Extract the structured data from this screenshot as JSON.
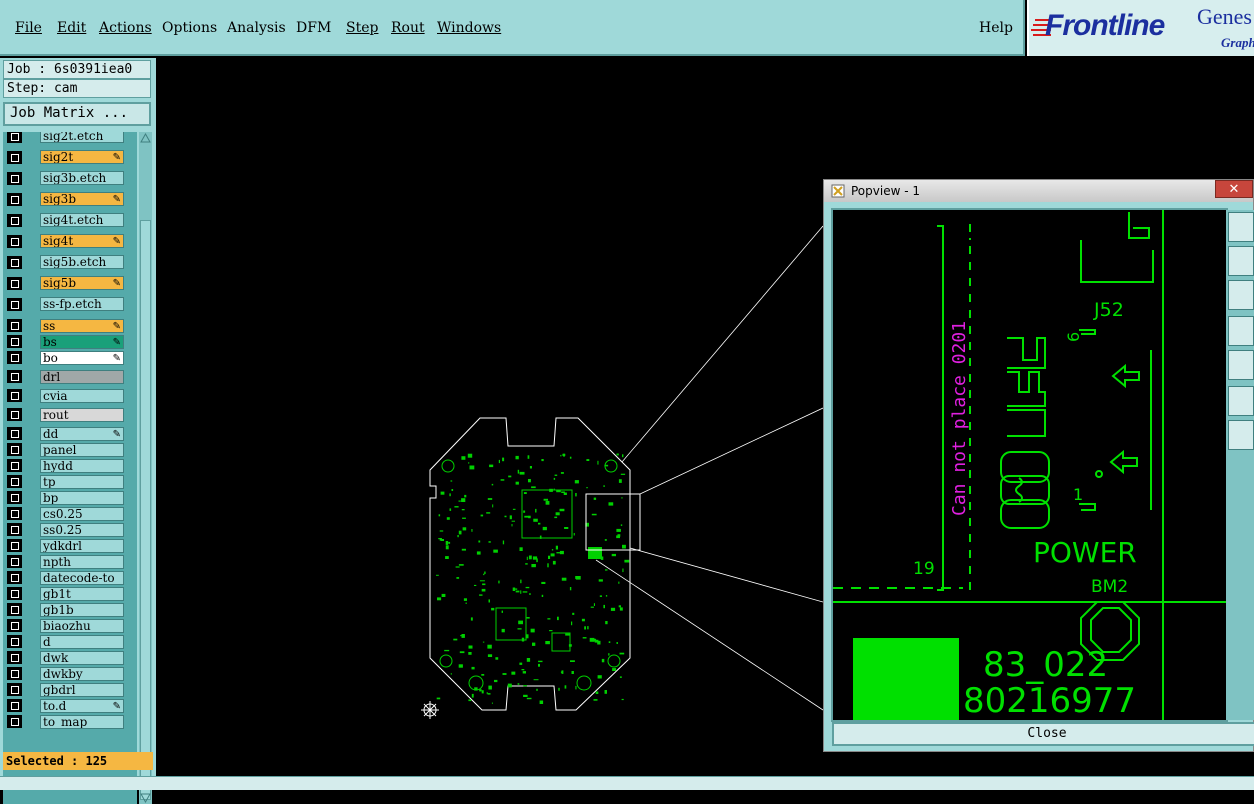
{
  "menu": {
    "items": [
      "File",
      "Edit",
      "Actions",
      "Options",
      "Analysis",
      "DFM",
      "Step",
      "Rout",
      "Windows"
    ],
    "help": "Help"
  },
  "brand": {
    "name": "Frontline",
    "product": "Genes",
    "sub": "Graph"
  },
  "job": {
    "job_label": "Job : 6s0391iea0",
    "step_label": "Step: cam",
    "matrix_button": "Job Matrix ..."
  },
  "layers": [
    {
      "name": "sig2t.etch",
      "color": "#9fd9d9",
      "mark": ""
    },
    {
      "name": "sig2t",
      "color": "#f5b742",
      "mark": "✎"
    },
    {
      "name": "sig3b.etch",
      "color": "#9fd9d9",
      "mark": ""
    },
    {
      "name": "sig3b",
      "color": "#f5b742",
      "mark": "✎"
    },
    {
      "name": "sig4t.etch",
      "color": "#9fd9d9",
      "mark": ""
    },
    {
      "name": "sig4t",
      "color": "#f5b742",
      "mark": "✎"
    },
    {
      "name": "sig5b.etch",
      "color": "#9fd9d9",
      "mark": ""
    },
    {
      "name": "sig5b",
      "color": "#f5b742",
      "mark": "✎"
    },
    {
      "name": "ss-fp.etch",
      "color": "#9fd9d9",
      "mark": ""
    },
    {
      "name": "ss",
      "color": "#f5b742",
      "mark": "✎"
    },
    {
      "name": "bs",
      "color": "#1aa07a",
      "mark": "✎"
    },
    {
      "name": "bo",
      "color": "#ffffff",
      "mark": "✎"
    },
    {
      "name": "drl",
      "color": "#a0a8a8",
      "mark": ""
    },
    {
      "name": "cvia",
      "color": "#9fd9d9",
      "mark": ""
    },
    {
      "name": "rout",
      "color": "#d8d8d8",
      "mark": ""
    },
    {
      "name": "dd",
      "color": "#9fd9d9",
      "mark": "✎"
    },
    {
      "name": "panel",
      "color": "#9fd9d9",
      "mark": ""
    },
    {
      "name": "hydd",
      "color": "#9fd9d9",
      "mark": ""
    },
    {
      "name": "tp",
      "color": "#9fd9d9",
      "mark": ""
    },
    {
      "name": "bp",
      "color": "#9fd9d9",
      "mark": ""
    },
    {
      "name": "cs0.25",
      "color": "#9fd9d9",
      "mark": ""
    },
    {
      "name": "ss0.25",
      "color": "#9fd9d9",
      "mark": ""
    },
    {
      "name": "ydkdrl",
      "color": "#9fd9d9",
      "mark": ""
    },
    {
      "name": "npth",
      "color": "#9fd9d9",
      "mark": ""
    },
    {
      "name": "datecode-to",
      "color": "#9fd9d9",
      "mark": ""
    },
    {
      "name": "gb1t",
      "color": "#9fd9d9",
      "mark": ""
    },
    {
      "name": "gb1b",
      "color": "#9fd9d9",
      "mark": ""
    },
    {
      "name": "biaozhu",
      "color": "#9fd9d9",
      "mark": ""
    },
    {
      "name": "d",
      "color": "#9fd9d9",
      "mark": ""
    },
    {
      "name": "dwk",
      "color": "#9fd9d9",
      "mark": ""
    },
    {
      "name": "dwkby",
      "color": "#9fd9d9",
      "mark": ""
    },
    {
      "name": "gbdrl",
      "color": "#9fd9d9",
      "mark": ""
    },
    {
      "name": "to.d",
      "color": "#9fd9d9",
      "mark": "✎"
    },
    {
      "name": "to_map",
      "color": "#9fd9d9",
      "mark": ""
    }
  ],
  "status": {
    "selected": "Selected : 125"
  },
  "popview": {
    "title": "Popview - 1",
    "close_x": "✕",
    "close_button": "Close",
    "annotation": "Can not place 0201",
    "num_19": "19",
    "j52": "J52",
    "pin6": "6",
    "pin1": "1",
    "power": "POWER",
    "bm2": "BM2",
    "code1": "83_022",
    "code2": "80216977"
  },
  "colors": {
    "accent": "#9fd9d9",
    "copper": "#00e000",
    "highlight": "#f5b742",
    "annotation": "#e020e0"
  }
}
